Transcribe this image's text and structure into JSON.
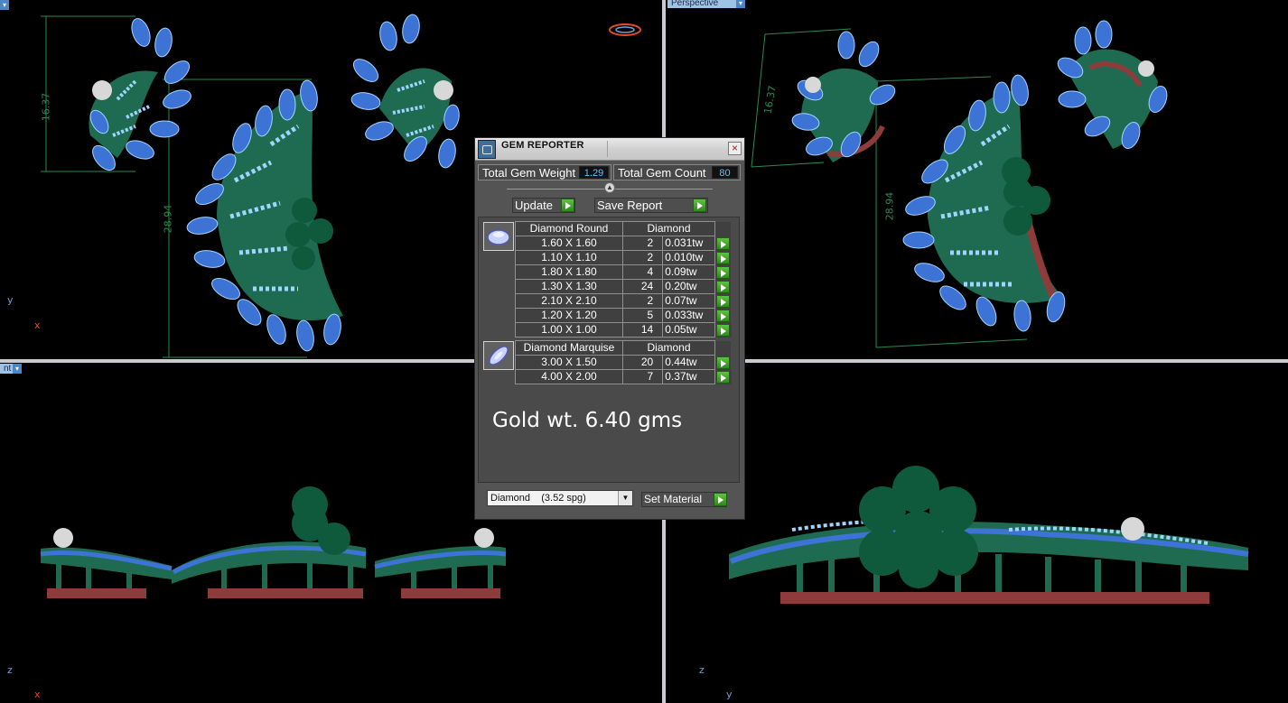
{
  "viewports": {
    "top_right_label": "Perspective",
    "bottom_left_label": "nt",
    "top_left_dims": [
      "16.37",
      "28.94"
    ],
    "top_right_dims": [
      "16.37",
      "28.94"
    ],
    "axes": {
      "top_left": [
        "y",
        "x"
      ],
      "bottom_left": [
        "z",
        "x"
      ],
      "bottom_right": [
        "z",
        "y"
      ]
    }
  },
  "colors": {
    "background": "#000000",
    "gold_metal": "#1f6b52",
    "gem_blue": "#3e73d6",
    "gem_light": "#9fd6ff",
    "emerald": "#0f5a3c",
    "base_red": "#8e3b3b",
    "prong_purple": "#7b32c8",
    "value_cyan": "#5fc4ff",
    "button_green": "#3aa82b"
  },
  "dialog": {
    "title": "GEM REPORTER",
    "close_icon": "×",
    "total_gem_weight_label": "Total Gem Weight",
    "total_gem_weight_value": "1.29",
    "total_gem_count_label": "Total Gem Count",
    "total_gem_count_value": "80",
    "update_label": "Update",
    "save_report_label": "Save Report",
    "groups": [
      {
        "shape": "Diamond Round",
        "material": "Diamond",
        "rows": [
          {
            "size": "1.60 X 1.60",
            "qty": "2",
            "weight": "0.031tw"
          },
          {
            "size": "1.10 X 1.10",
            "qty": "2",
            "weight": "0.010tw"
          },
          {
            "size": "1.80 X 1.80",
            "qty": "4",
            "weight": "0.09tw"
          },
          {
            "size": "1.30 X 1.30",
            "qty": "24",
            "weight": "0.20tw"
          },
          {
            "size": "2.10 X 2.10",
            "qty": "2",
            "weight": "0.07tw"
          },
          {
            "size": "1.20 X 1.20",
            "qty": "5",
            "weight": "0.033tw"
          },
          {
            "size": "1.00 X 1.00",
            "qty": "14",
            "weight": "0.05tw"
          }
        ]
      },
      {
        "shape": "Diamond Marquise",
        "material": "Diamond",
        "rows": [
          {
            "size": "3.00 X 1.50",
            "qty": "20",
            "weight": "0.44tw"
          },
          {
            "size": "4.00 X 2.00",
            "qty": "7",
            "weight": "0.37tw"
          }
        ]
      }
    ],
    "note": "Gold wt. 6.40 gms",
    "material_select": "Diamond    (3.52 spg)",
    "set_material_label": "Set Material"
  }
}
